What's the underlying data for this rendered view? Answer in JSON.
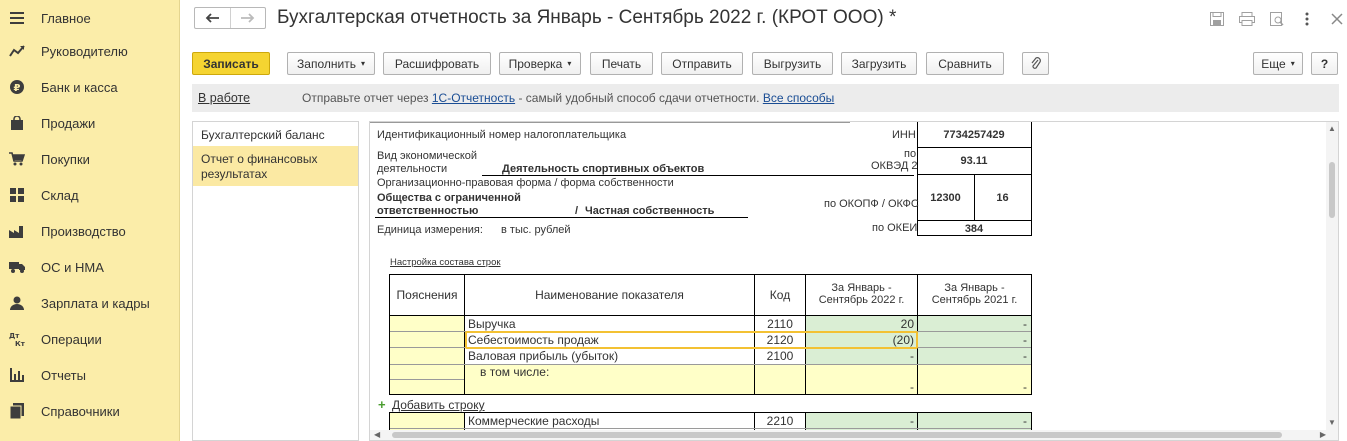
{
  "sidebar": {
    "items": [
      {
        "label": "Главное",
        "icon": "menu-icon"
      },
      {
        "label": "Руководителю",
        "icon": "chart-trend-icon"
      },
      {
        "label": "Банк и касса",
        "icon": "ruble-icon"
      },
      {
        "label": "Продажи",
        "icon": "bag-icon"
      },
      {
        "label": "Покупки",
        "icon": "cart-icon"
      },
      {
        "label": "Склад",
        "icon": "warehouse-icon"
      },
      {
        "label": "Производство",
        "icon": "factory-icon"
      },
      {
        "label": "ОС и НМА",
        "icon": "truck-icon"
      },
      {
        "label": "Зарплата и кадры",
        "icon": "person-icon"
      },
      {
        "label": "Операции",
        "icon": "dt-kt-icon"
      },
      {
        "label": "Отчеты",
        "icon": "bar-chart-icon"
      },
      {
        "label": "Справочники",
        "icon": "books-icon"
      }
    ],
    "dtkt": {
      "top": "Дт",
      "bottom": "Кт"
    }
  },
  "header": {
    "title": "Бухгалтерская отчетность за Январь - Сентябрь 2022 г. (КРОТ ООО) *"
  },
  "toolbar": {
    "save": "Записать",
    "fill": "Заполнить",
    "decode": "Расшифровать",
    "check": "Проверка",
    "print": "Печать",
    "send": "Отправить",
    "export": "Выгрузить",
    "import": "Загрузить",
    "compare": "Сравнить",
    "more": "Еще",
    "help": "?"
  },
  "infobar": {
    "status": "В работе",
    "msg_prefix": "Отправьте отчет через",
    "msg_link": "1С-Отчетность",
    "msg_middle": "- самый удобный способ сдачи отчетности.",
    "msg_link2": "Все способы"
  },
  "sections": [
    {
      "label": "Бухгалтерский баланс",
      "active": false
    },
    {
      "label": "Отчет о финансовых результатах",
      "active": true
    }
  ],
  "report": {
    "inn_label": "Идентификационный номер налогоплательщика",
    "inn_code_label": "ИНН",
    "inn": "7734257429",
    "activity_label_1": "Вид экономической",
    "activity_label_2": "деятельности",
    "activity_value": "Деятельность спортивных объектов",
    "okved_label_1": "по",
    "okved_label_2": "ОКВЭД 2",
    "okved": "93.11",
    "legal_form_label": "Организационно-правовая форма / форма собственности",
    "legal_form_1": "Общества с ограниченной",
    "legal_form_2": "ответственностью",
    "slash": "/",
    "ownership": "Частная собственность",
    "okopf_label": "по ОКОПФ / ОКФС",
    "okopf": "12300",
    "okfs": "16",
    "unit_label": "Единица измерения:",
    "unit_value": "в тыс. рублей",
    "okei_label": "по ОКЕИ",
    "okei": "384",
    "settings_link": "Настройка состава строк",
    "add_row": "Добавить строку",
    "add_sign": "+",
    "columns": {
      "notes": "Пояснения",
      "name": "Наименование показателя",
      "code": "Код",
      "cur_1": "За Январь -",
      "cur_2": "Сентябрь 2022 г.",
      "prev_1": "За Январь -",
      "prev_2": "Сентябрь 2021 г."
    },
    "rows": [
      {
        "name": "Выручка",
        "code": "2110",
        "cur": "20",
        "prev": "-"
      },
      {
        "name": "Себестоимость продаж",
        "code": "2120",
        "cur": "(20)",
        "prev": "-"
      },
      {
        "name": "Валовая прибыль (убыток)",
        "code": "2100",
        "cur": "-",
        "prev": "-"
      },
      {
        "name": "в том числе:",
        "code": "",
        "cur": "-",
        "prev": "-"
      }
    ],
    "rows2": [
      {
        "name": "Коммерческие расходы",
        "code": "2210",
        "cur": "-",
        "prev": "-"
      }
    ]
  },
  "colors": {
    "sidebar": "#fbeda9",
    "primary_button": "#f5d431",
    "cell_yellow": "#ffffc8",
    "cell_green": "#daeed4",
    "selection": "#f3c133",
    "link": "#1a4d94"
  }
}
